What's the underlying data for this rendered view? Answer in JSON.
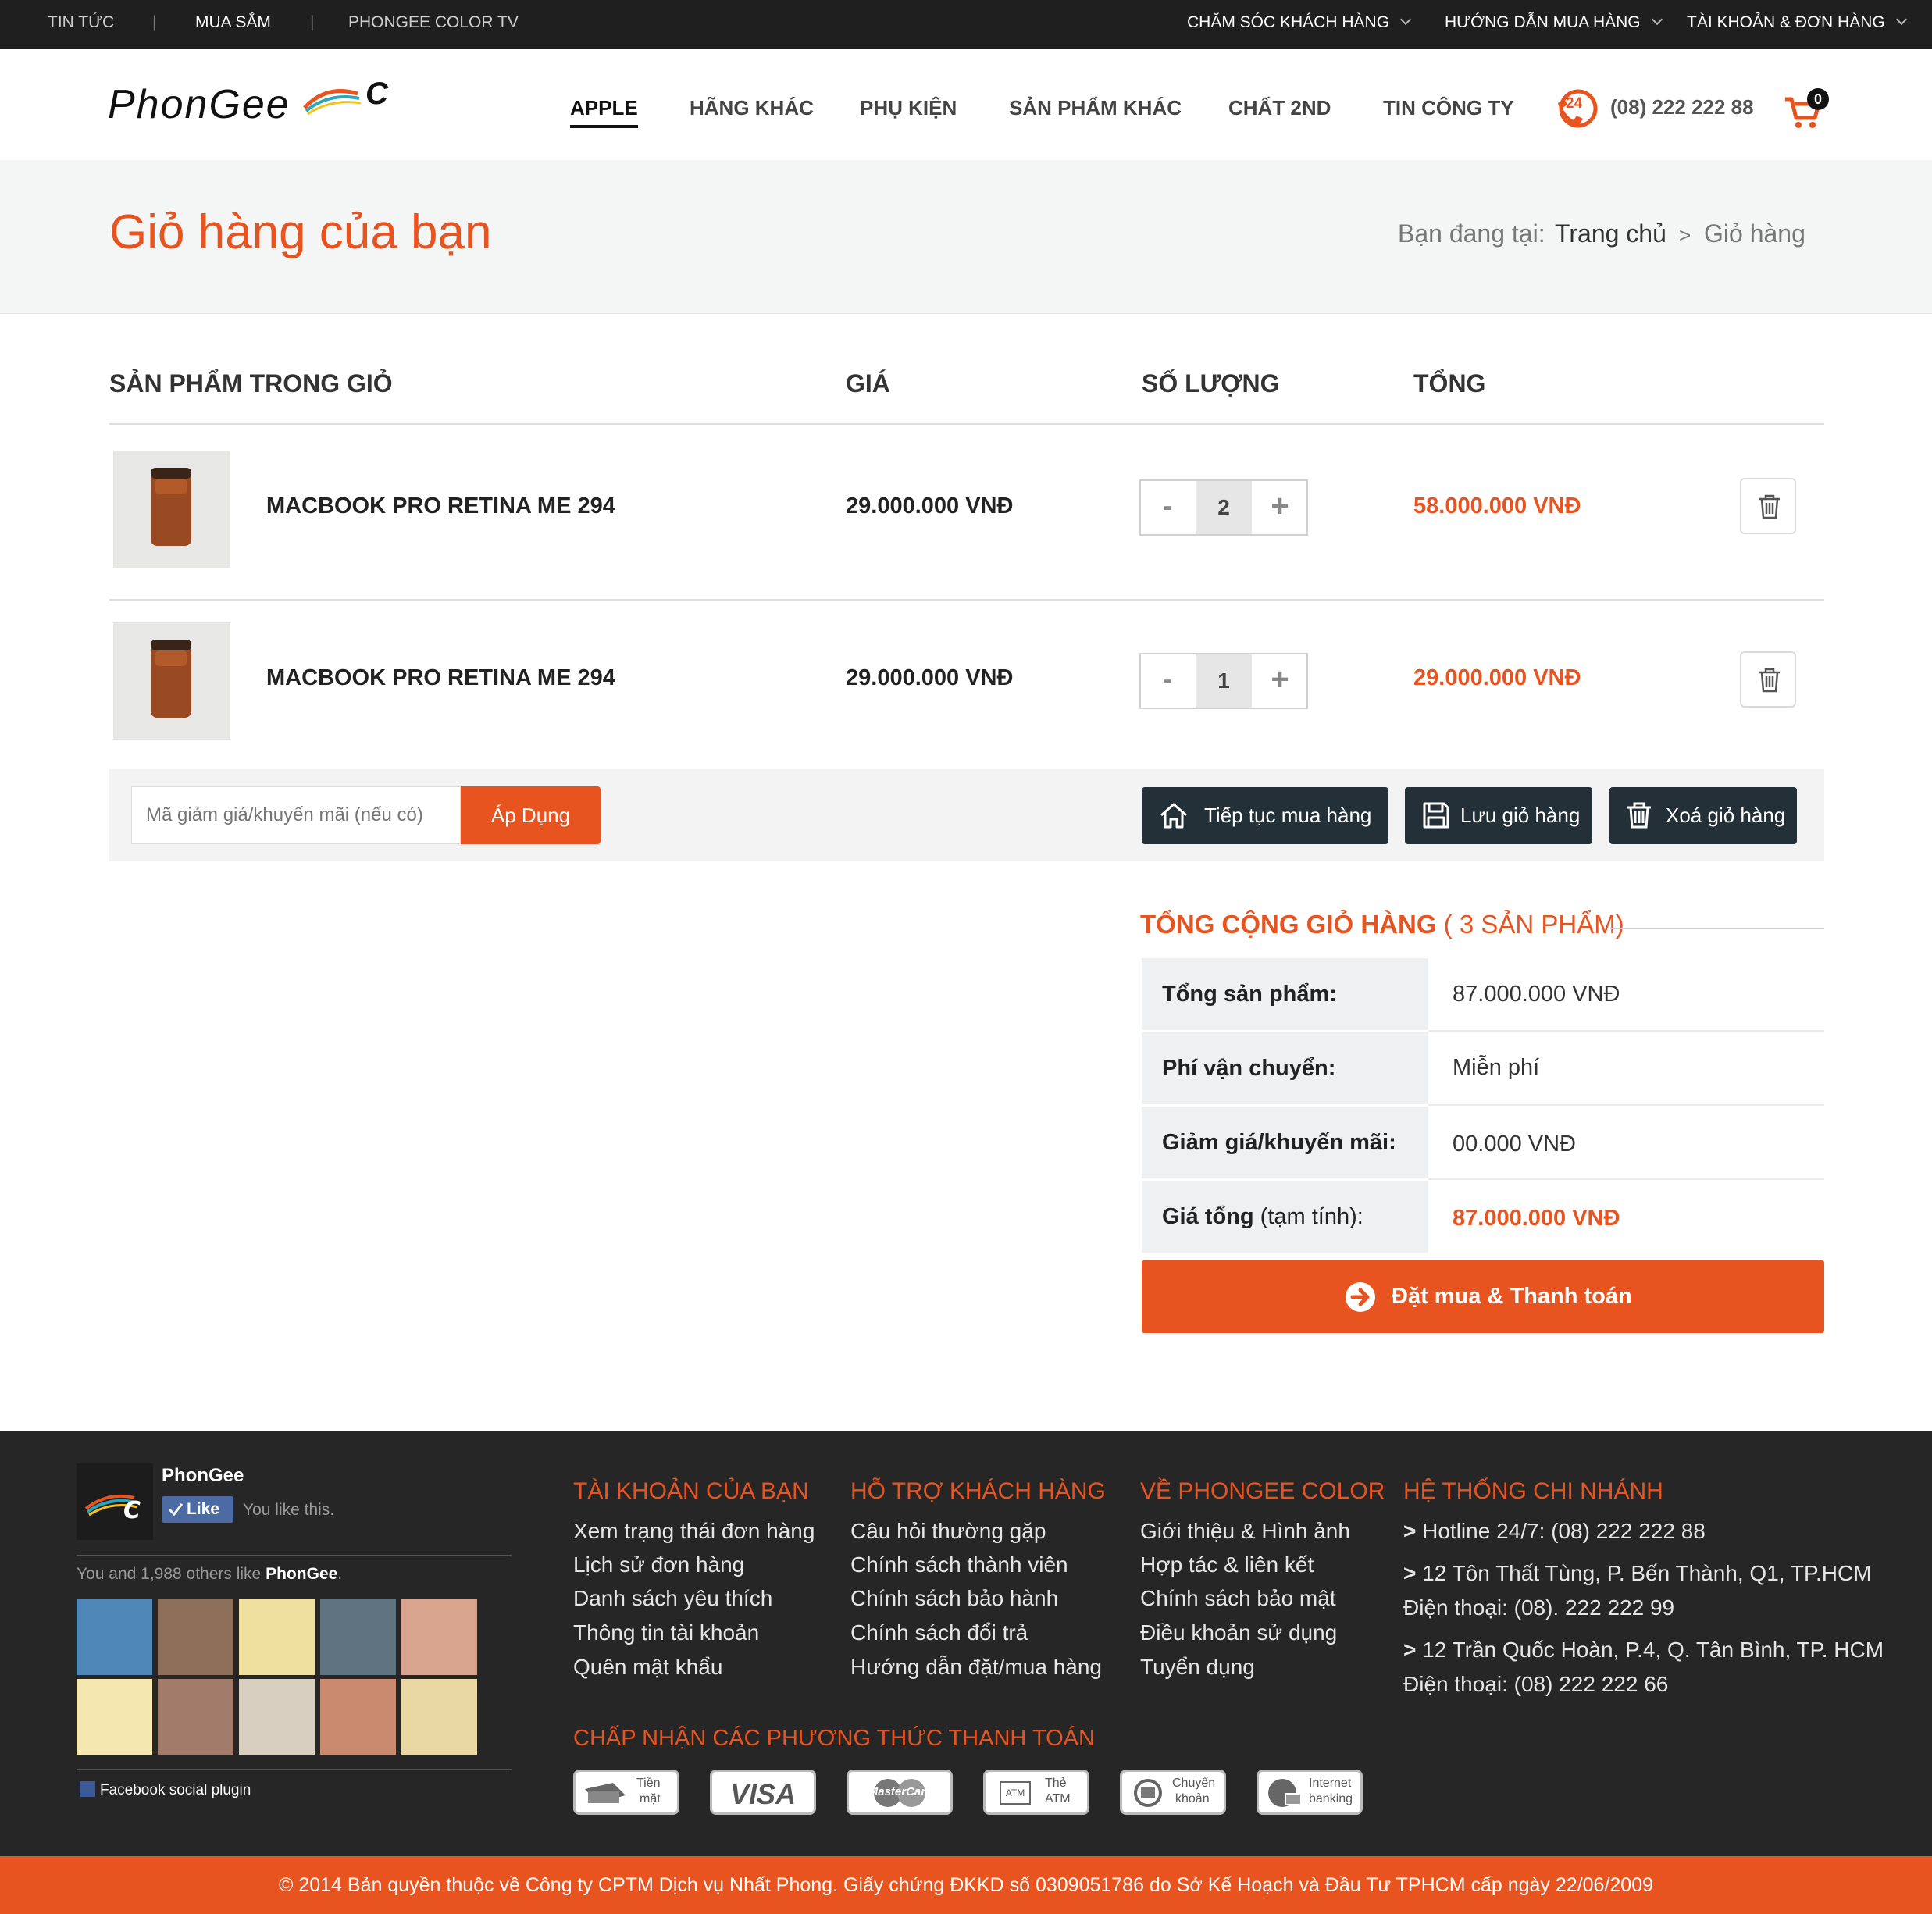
{
  "topbar": {
    "left_links": [
      "TIN TỨC",
      "MUA SẮM",
      "PHONGEE COLOR TV"
    ],
    "separator": "|",
    "right_links": [
      "CHĂM SÓC KHÁCH HÀNG",
      "HƯỚNG DẪN MUA HÀNG",
      "TÀI KHOẢN & ĐƠN HÀNG"
    ]
  },
  "header": {
    "logo_text": "PhonGee",
    "logo_mark": "C",
    "nav": [
      "APPLE",
      "HÃNG KHÁC",
      "PHỤ KIỆN",
      "SẢN PHẨM KHÁC",
      "CHẤT 2ND",
      "TIN CÔNG TY"
    ],
    "hotline_badge": "24",
    "phone": "(08) 222 222 88",
    "cart_count": "0"
  },
  "page": {
    "title": "Giỏ hàng của bạn",
    "breadcrumb_prefix": "Bạn đang tại:",
    "breadcrumb_home": "Trang chủ",
    "breadcrumb_sep": ">",
    "breadcrumb_current": "Giỏ hàng"
  },
  "cart": {
    "headers": [
      "SẢN PHẨM TRONG GIỎ",
      "GIÁ",
      "SỐ LƯỢNG",
      "TỔNG"
    ],
    "items": [
      {
        "name": "MACBOOK PRO RETINA ME 294",
        "price": "29.000.000 VNĐ",
        "qty": "2",
        "total": "58.000.000 VNĐ"
      },
      {
        "name": "MACBOOK PRO RETINA ME 294",
        "price": "29.000.000 VNĐ",
        "qty": "1",
        "total": "29.000.000 VNĐ"
      }
    ],
    "minus": "-",
    "plus": "+",
    "coupon_placeholder": "Mã giảm giá/khuyến mãi (nếu có)",
    "apply_label": "Áp Dụng",
    "continue_label": "Tiếp tục mua hàng",
    "save_label": "Lưu giỏ hàng",
    "clear_label": "Xoá giỏ hàng"
  },
  "summary": {
    "title": "TỔNG CỘNG GIỎ HÀNG",
    "count": "( 3 SẢN PHẨM)",
    "subtotal_label": "Tổng sản phẩm:",
    "subtotal": "87.000.000 VNĐ",
    "shipping_label": "Phí vận chuyển:",
    "shipping": "Miễn phí",
    "discount_label": "Giảm giá/khuyến mãi:",
    "discount": "00.000 VNĐ",
    "grand_label": "Giá tổng",
    "grand_note": "(tạm tính):",
    "grand": "87.000.000 VNĐ",
    "order_label": "Đặt mua & Thanh toán"
  },
  "facebook": {
    "page_name": "PhonGee",
    "like_label": "Like",
    "you_like": "You like this.",
    "others_prefix": "You and 1,988 others like ",
    "others_name": "PhonGee",
    "others_suffix": ".",
    "plugin_label": "Facebook social plugin"
  },
  "footer": {
    "col1_title": "TÀI KHOẢN CỦA BẠN",
    "col1": [
      "Xem trạng thái đơn hàng",
      "Lịch sử đơn hàng",
      "Danh sách yêu thích",
      "Thông tin tài khoản",
      "Quên mật khẩu"
    ],
    "col2_title": "HỖ TRỢ KHÁCH HÀNG",
    "col2": [
      "Câu hỏi thường gặp",
      "Chính sách thành viên",
      "Chính sách bảo hành",
      "Chính sách đổi trả",
      "Hướng dẫn đặt/mua hàng"
    ],
    "col3_title": "VỀ PHONGEE COLOR",
    "col3": [
      "Giới thiệu & Hình ảnh",
      "Hợp tác & liên kết",
      "Chính sách bảo mật",
      "Điều khoản sử dụng",
      "Tuyển dụng"
    ],
    "col4_title": "HỆ THỐNG CHI NHÁNH",
    "col4": [
      "Hotline 24/7:  (08) 222 222 88",
      "12 Tôn Thất Tùng, P. Bến Thành, Q1, TP.HCM",
      "Điện thoại: (08). 222 222 99",
      "12 Trần Quốc Hoàn, P.4, Q. Tân Bình, TP. HCM",
      "Điện thoại: (08) 222 222 66"
    ],
    "bullet": ">",
    "pay_title": "CHẤP NHẬN CÁC PHƯƠNG THỨC THANH TOÁN",
    "pay": [
      {
        "line1": "Tiền",
        "line2": "mặt"
      },
      {
        "line1": "VISA",
        "line2": ""
      },
      {
        "line1": "MasterCard",
        "line2": ""
      },
      {
        "line1": "Thẻ",
        "line2": "ATM"
      },
      {
        "line1": "Chuyển",
        "line2": "khoản"
      },
      {
        "line1": "Internet",
        "line2": "banking"
      }
    ],
    "atm_tag": "ATM",
    "copyright": "© 2014 Bản quyền thuộc về Công ty CPTM Dịch vụ Nhất Phong. Giấy chứng ĐKKD số 0309051786 do Sở Kế Hoạch và Đầu Tư TPHCM cấp ngày 22/06/2009"
  },
  "colors": {
    "accent": "#e8541f",
    "dark": "#1f1f1f",
    "button_dark": "#243038"
  }
}
